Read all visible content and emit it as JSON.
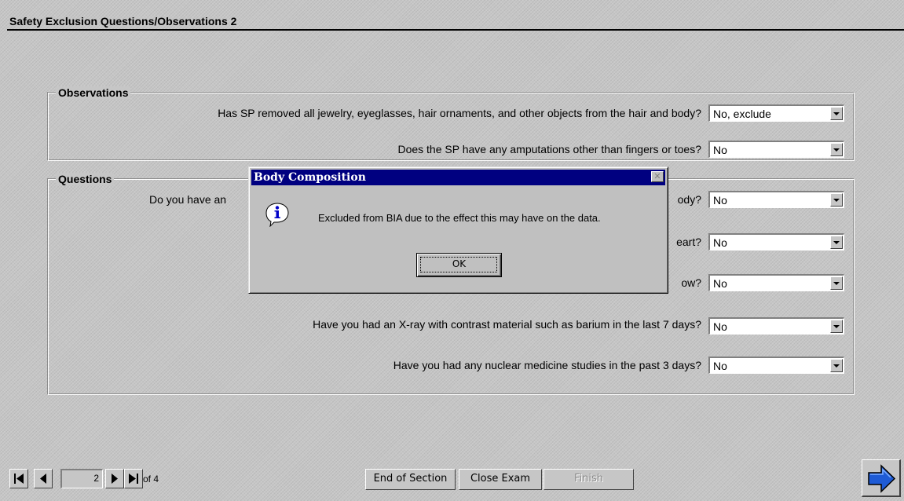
{
  "page": {
    "title": "Safety Exclusion Questions/Observations 2"
  },
  "observations": {
    "legend": "Observations",
    "items": [
      {
        "question": "Has SP removed all jewelry, eyeglasses, hair ornaments, and other objects from the hair and body?",
        "value": "No, exclude"
      },
      {
        "question": "Does the SP have any amputations other than fingers or toes?",
        "value": "No"
      }
    ]
  },
  "questions": {
    "legend": "Questions",
    "items": [
      {
        "question_start": "Do you have an",
        "question_end": "ody?",
        "value": "No"
      },
      {
        "question_end": "eart?",
        "value": "No"
      },
      {
        "question_end": "ow?",
        "value": "No"
      },
      {
        "question": "Have you had an X-ray with contrast material such as barium in the last 7 days?",
        "value": "No"
      },
      {
        "question": "Have you had any nuclear medicine studies in the past 3 days?",
        "value": "No"
      }
    ]
  },
  "dialog": {
    "title": "Body Composition",
    "close_glyph": "✕",
    "message": "Excluded from BIA due to the effect this may have on the data.",
    "ok_label": "OK",
    "icon": "info-icon"
  },
  "nav": {
    "current_page": "2",
    "of_label": "of 4",
    "end_section_label": "End of Section",
    "close_exam_label": "Close Exam",
    "finish_label": "Finish",
    "next_icon": "next-arrow-icon"
  },
  "colors": {
    "background": "#c6c6c6",
    "dialog_titlebar": "#000080",
    "next_arrow": "#1e5bd6"
  }
}
